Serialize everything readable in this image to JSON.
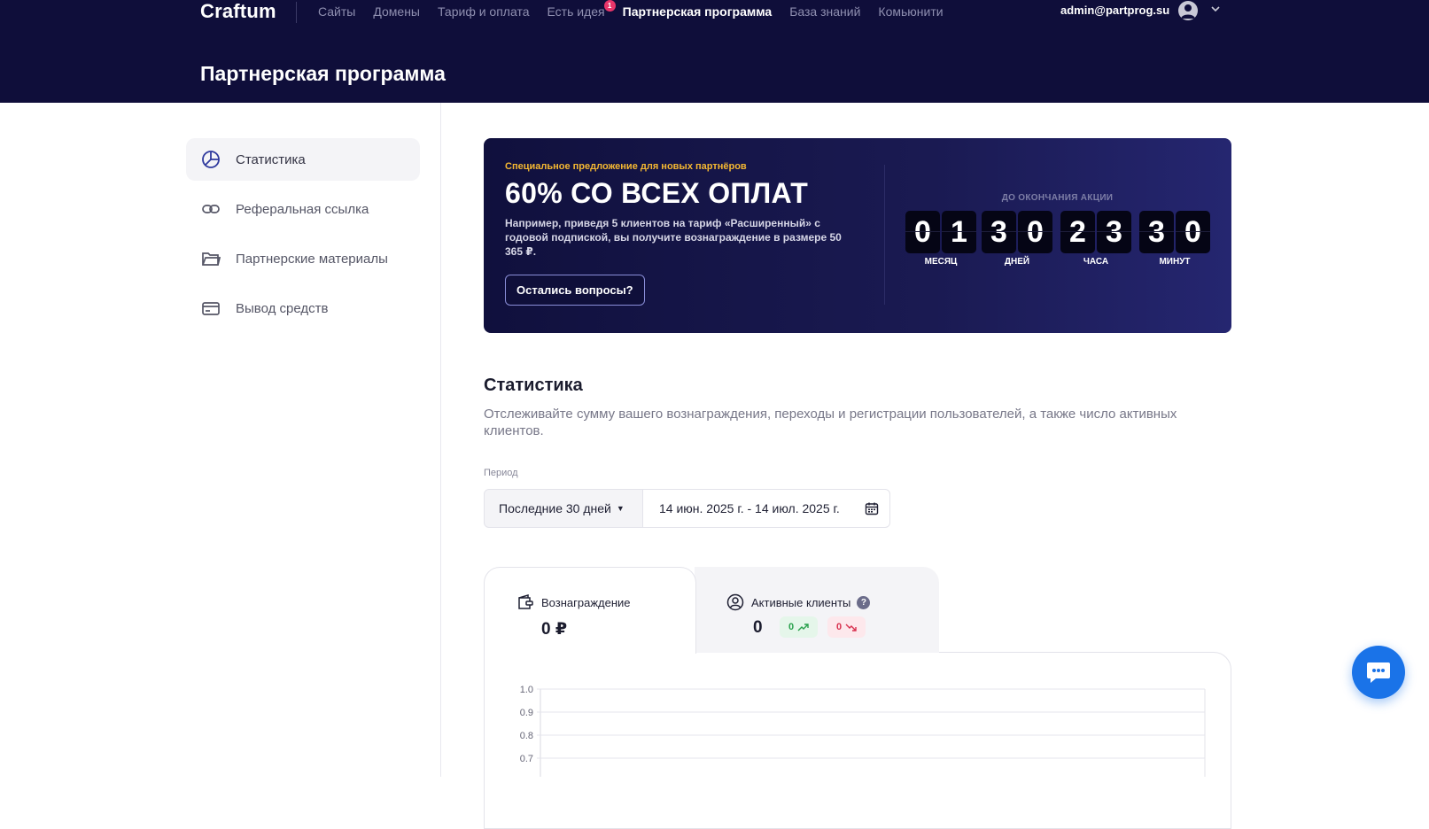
{
  "brand": {
    "logo": "Craftum"
  },
  "nav": {
    "items": [
      {
        "label": "Сайты",
        "active": false
      },
      {
        "label": "Домены",
        "active": false
      },
      {
        "label": "Тариф и оплата",
        "active": false
      },
      {
        "label": "Есть идея",
        "active": false,
        "badge": "1"
      },
      {
        "label": "Партнерская программа",
        "active": true
      },
      {
        "label": "База знаний",
        "active": false
      },
      {
        "label": "Комьюнити",
        "active": false
      }
    ],
    "user_email": "admin@partprog.su"
  },
  "page": {
    "title": "Партнерская программа"
  },
  "sidebar": {
    "items": [
      {
        "label": "Статистика",
        "icon": "pie-chart-icon",
        "active": true
      },
      {
        "label": "Реферальная ссылка",
        "icon": "link-icon",
        "active": false
      },
      {
        "label": "Партнерские материалы",
        "icon": "folder-icon",
        "active": false
      },
      {
        "label": "Вывод средств",
        "icon": "credit-card-icon",
        "active": false
      }
    ]
  },
  "promo": {
    "tag": "Специальное предложение для новых партнёров",
    "headline": "60% СО ВСЕХ ОПЛАТ",
    "description": "Например, приведя 5 клиентов на тариф «Расширенный» с годовой подпиской, вы получите вознаграждение в размере 50 365 ₽.",
    "button": "Остались вопросы?",
    "countdown_title": "ДО ОКОНЧАНИЯ АКЦИИ",
    "countdown": [
      {
        "d1": "0",
        "d2": "1",
        "label": "МЕСЯЦ"
      },
      {
        "d1": "3",
        "d2": "0",
        "label": "ДНЕЙ"
      },
      {
        "d1": "2",
        "d2": "3",
        "label": "ЧАСА"
      },
      {
        "d1": "3",
        "d2": "0",
        "label": "МИНУТ"
      }
    ]
  },
  "stats": {
    "title": "Статистика",
    "description": "Отслеживайте сумму вашего вознаграждения, переходы и регистрации пользователей, а также число активных клиентов.",
    "period_label": "Период",
    "period_value": "Последние 30 дней",
    "date_range": "14 июн. 2025 г. - 14 июл. 2025 г.",
    "tabs": [
      {
        "label": "Вознаграждение",
        "value": "0 ₽",
        "icon": "wallet-icon"
      },
      {
        "label": "Активные клиенты",
        "value": "0",
        "icon": "user-circle-icon",
        "help": "?",
        "trend_up": "0",
        "trend_down": "0"
      }
    ]
  },
  "chart_data": {
    "type": "line",
    "title": "",
    "xlabel": "",
    "ylabel": "",
    "ylim": [
      0,
      1.0
    ],
    "yticks_visible": [
      "1.0",
      "0.9",
      "0.8",
      "0.7"
    ],
    "grid": true,
    "series": []
  },
  "colors": {
    "header_bg": "#0f0e3a",
    "accent": "#1a73e8",
    "promo_tag": "#f5b832",
    "trend_up": "#2aa14d",
    "trend_down": "#d8314f"
  }
}
